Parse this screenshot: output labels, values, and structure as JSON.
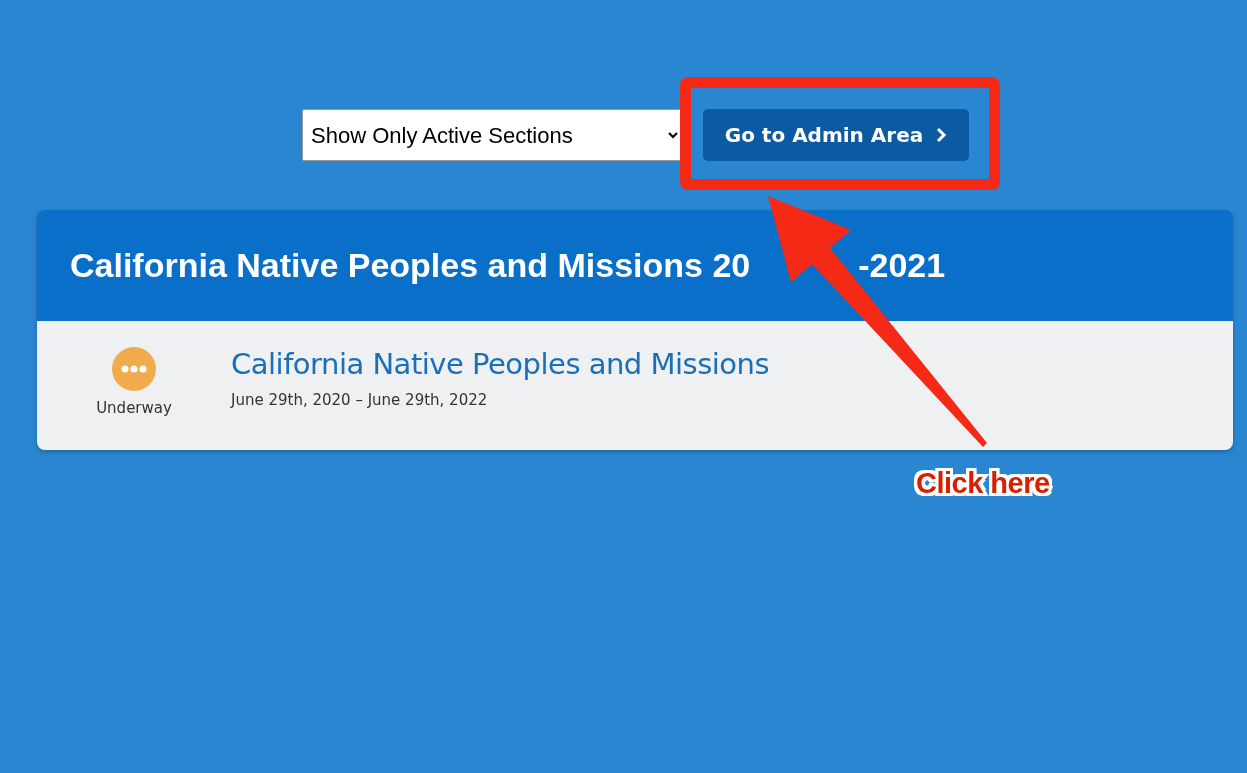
{
  "filter": {
    "value": "Show Only Active Sections"
  },
  "admin_button": {
    "label": "Go to Admin Area"
  },
  "course_group": {
    "title_start": "California Native Peoples and Missions 20",
    "title_end": "-2021",
    "sections": [
      {
        "title": "California Native Peoples and Missions",
        "dates": "June 29th, 2020 – June 29th, 2022",
        "status": "Underway",
        "kind": "underway"
      }
    ]
  },
  "annotation": {
    "label": "Click here"
  }
}
